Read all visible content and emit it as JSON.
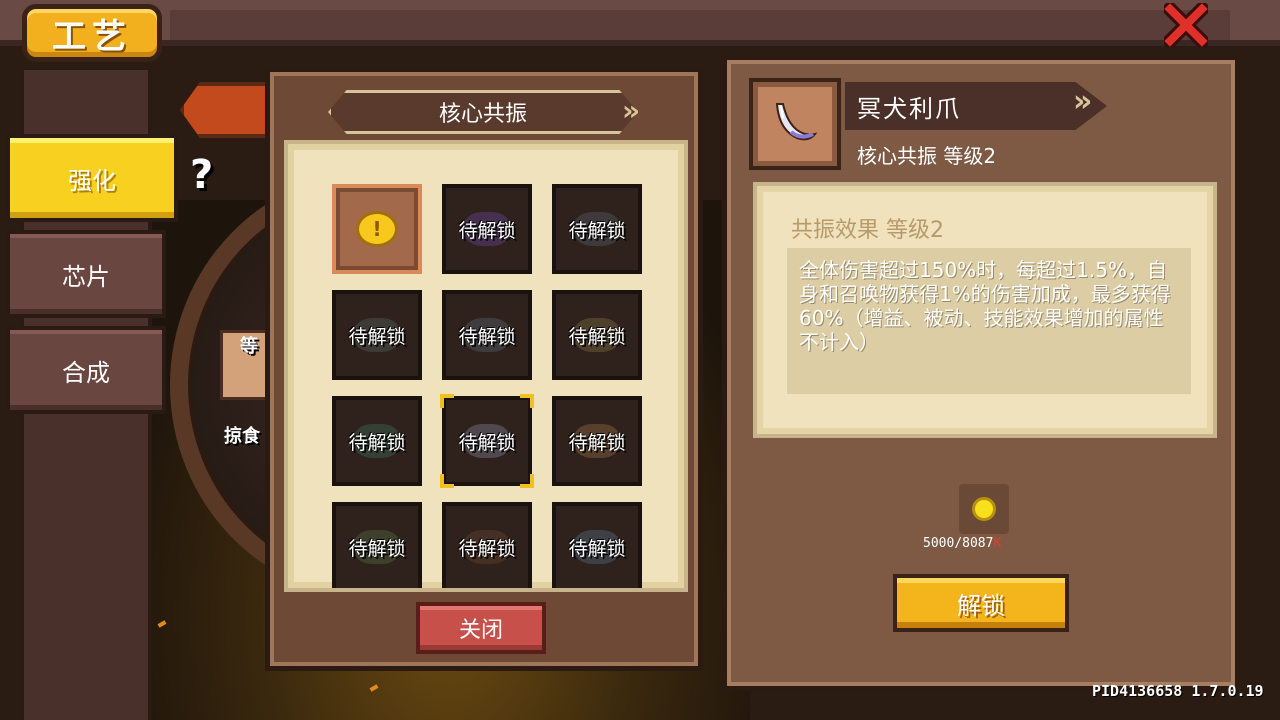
{
  "header": {
    "title": "工艺"
  },
  "side_tabs": [
    {
      "label": "强化",
      "active": true
    },
    {
      "label": "芯片",
      "active": false
    },
    {
      "label": "合成",
      "active": false
    }
  ],
  "background_fragments": {
    "help_mark": "?",
    "card_label_top": "等",
    "card_label_bottom": "掠食"
  },
  "resonance_modal": {
    "title": "核心共振",
    "slots": [
      {
        "label": "",
        "state": "unlocked",
        "icon": "coin-icon",
        "tint": "#f8c81c"
      },
      {
        "label": "待解锁",
        "state": "locked",
        "icon": "purple-gear-icon",
        "tint": "#5a3a7a"
      },
      {
        "label": "待解锁",
        "state": "locked",
        "icon": "gray-gear-icon",
        "tint": "#4a4e56"
      },
      {
        "label": "待解锁",
        "state": "locked",
        "icon": "gray-gear-icon",
        "tint": "#4a4e4a"
      },
      {
        "label": "待解锁",
        "state": "locked",
        "icon": "gray-gear-icon",
        "tint": "#4a525a"
      },
      {
        "label": "待解锁",
        "state": "locked",
        "icon": "gold-gear-icon",
        "tint": "#6a5a3a"
      },
      {
        "label": "待解锁",
        "state": "locked",
        "icon": "green-gear-icon",
        "tint": "#3a5a4a"
      },
      {
        "label": "待解锁",
        "state": "selected",
        "icon": "claw-icon",
        "tint": "#6a6a7a"
      },
      {
        "label": "待解锁",
        "state": "locked",
        "icon": "brown-gear-icon",
        "tint": "#7a5a3a"
      },
      {
        "label": "待解锁",
        "state": "locked",
        "icon": "green-gear-icon",
        "tint": "#4a5a3a"
      },
      {
        "label": "待解锁",
        "state": "locked",
        "icon": "brown-gear-icon",
        "tint": "#5a3a2a"
      },
      {
        "label": "待解锁",
        "state": "locked",
        "icon": "gray-gear-icon",
        "tint": "#4a5a6a"
      }
    ],
    "close_label": "关闭"
  },
  "detail_panel": {
    "item_name": "冥犬利爪",
    "item_subtitle": "核心共振 等级2",
    "effect_title": "共振效果 等级2",
    "effect_text": "全体伤害超过150%时，每超过1.5%，自身和召唤物获得1%的伤害加成，最多获得60%（增益、被动、技能效果增加的属性不计入）",
    "cost_icon": "gold-coin-icon",
    "cost_current": "5000",
    "cost_separator": "/",
    "cost_required": "8087",
    "cost_suffix": "K",
    "unlock_label": "解锁"
  },
  "version_text": "PID4136658 1.7.0.19",
  "colors": {
    "accent_gold": "#f4b41c",
    "close_red": "#c8504a",
    "panel_brown": "#7e5a44",
    "parchment": "#efe2bc",
    "cost_k_red": "#e04030"
  }
}
